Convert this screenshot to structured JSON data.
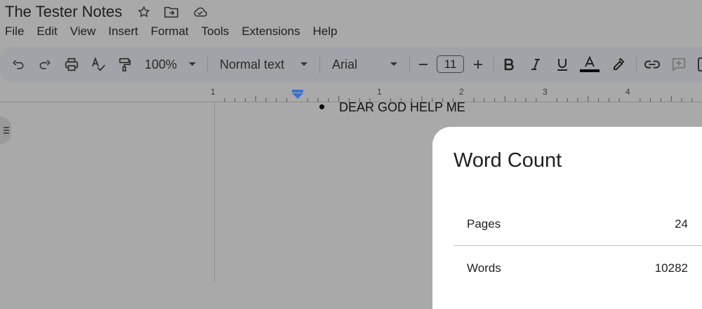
{
  "document": {
    "title": "The Tester Notes"
  },
  "menu": [
    "File",
    "Edit",
    "View",
    "Insert",
    "Format",
    "Tools",
    "Extensions",
    "Help"
  ],
  "toolbar": {
    "zoom": "100%",
    "style": "Normal text",
    "font": "Arial",
    "font_size": "11",
    "text_color": "#000000"
  },
  "ruler": {
    "labels": [
      "1",
      "1",
      "2",
      "3",
      "4"
    ]
  },
  "body": {
    "bullet_text": "DEAR GOD HELP ME"
  },
  "word_count": {
    "title": "Word Count",
    "rows": [
      {
        "label": "Pages",
        "value": "24"
      },
      {
        "label": "Words",
        "value": "10282"
      }
    ]
  }
}
